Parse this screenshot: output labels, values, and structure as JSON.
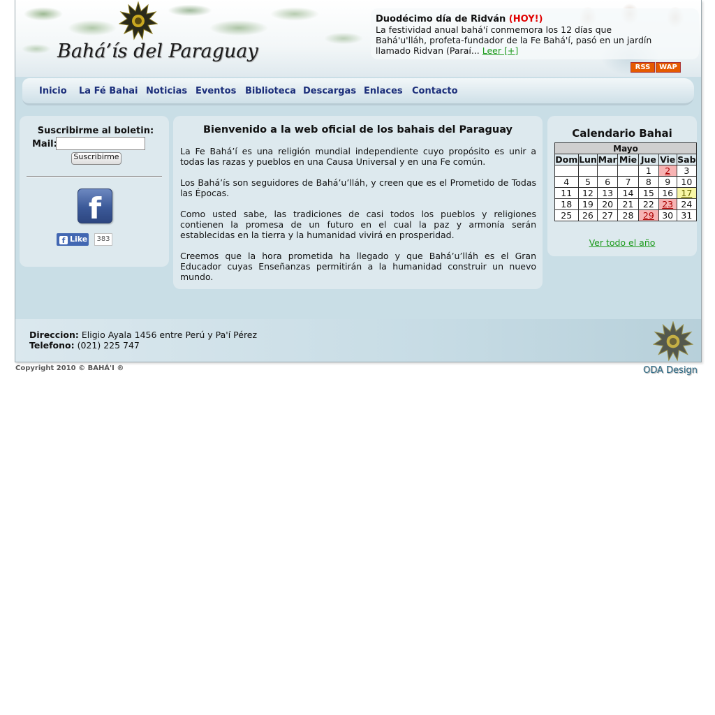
{
  "header": {
    "site_title": "Bahá’ís del Paraguay",
    "news_title": "Duodécimo día de Ridván",
    "news_hoy": "(HOY!)",
    "news_body": "La festividad anual bahá'í conmemora los 12 días que Bahá'u'lláh, profeta-fundador de la Fe Bahá'í, pasó en un jardín llamado Ridvan (Paraí...",
    "news_more": "Leer [+]",
    "rss": "RSS",
    "wap": "WAP"
  },
  "menu": [
    "Inicio",
    "La Fé Bahai",
    "Noticias",
    "Eventos",
    "Biblioteca",
    "Descargas",
    "Enlaces",
    "Contacto"
  ],
  "newsletter": {
    "title": "Suscribirme al boletin:",
    "mail_label": "Mail:",
    "mail_value": "",
    "button": "Suscribirme",
    "fb_letter": "f",
    "like_label": "Like",
    "like_count": "383"
  },
  "welcome": {
    "title": "Bienvenido a la web oficial de los bahais del Paraguay",
    "p1": "La Fe Bahá’í es una religión mundial independiente cuyo propósito es unir a todas las razas y pueblos en una Causa Universal y en una Fe común.",
    "p2": "Los Bahá’ís son seguidores de Bahá’u’lláh, y creen que es el Prometido de Todas las Épocas.",
    "p3": " Como usted sabe, las tradiciones de casi todos los pueblos y religiones contienen la promesa de un futuro en el cual la paz y armonía serán establecidas en la tierra y la humanidad vivirá en prosperidad.",
    "p4": "Creemos que la hora prometida ha llegado y que Bahá’u’lláh es el Gran Educador cuyas Enseñanzas permitirán a la humanidad construir un nuevo mundo."
  },
  "calendar": {
    "title": "Calendario Bahai",
    "month": "Mayo",
    "days": [
      "Dom",
      "Lun",
      "Mar",
      "Mie",
      "Jue",
      "Vie",
      "Sab"
    ],
    "weeks": [
      [
        "",
        "",
        "",
        "",
        "1",
        "2",
        "3"
      ],
      [
        "4",
        "5",
        "6",
        "7",
        "8",
        "9",
        "10"
      ],
      [
        "11",
        "12",
        "13",
        "14",
        "15",
        "16",
        "17"
      ],
      [
        "18",
        "19",
        "20",
        "21",
        "22",
        "23",
        "24"
      ],
      [
        "25",
        "26",
        "27",
        "28",
        "29",
        "30",
        "31"
      ]
    ],
    "highlight_red": [
      "2",
      "23",
      "29"
    ],
    "highlight_yellow": [
      "17"
    ],
    "link": "Ver todo el año"
  },
  "footer": {
    "addr_label": "Direccion:",
    "addr_value": "Eligio Ayala 1456 entre Perú y Pa'í Pérez",
    "tel_label": "Telefono:",
    "tel_value": "(021) 225 747",
    "copyright": "Copyright 2010 © BAHÁ'I ®",
    "designer": "ODA Design"
  },
  "colors": {
    "menu_text": "#1b2e7a",
    "link_green": "#1a9a1a",
    "hoy_red": "#e00000",
    "rss_orange": "#e55a00"
  }
}
